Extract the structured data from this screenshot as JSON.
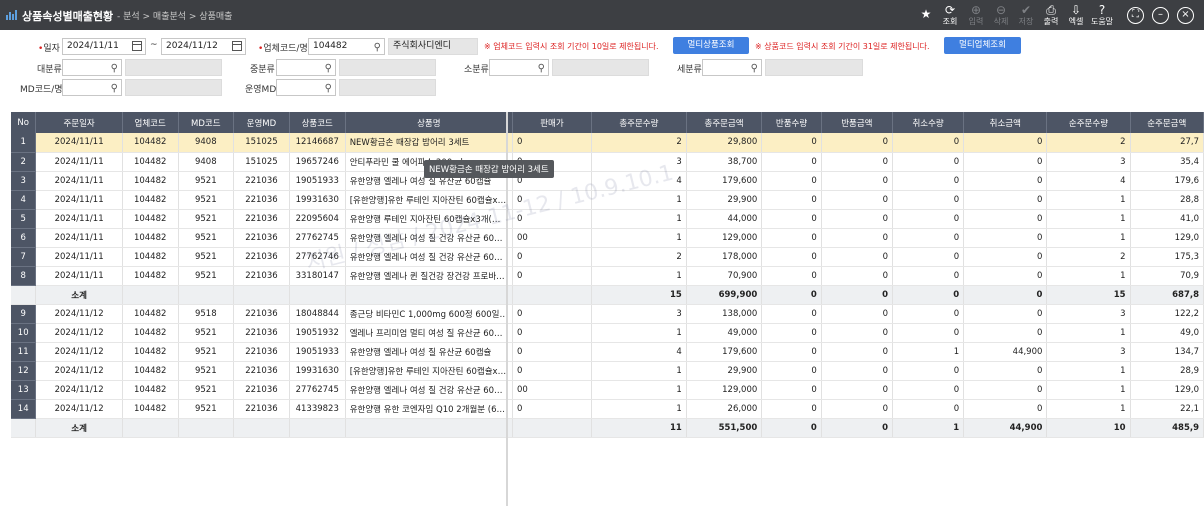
{
  "title": "상품속성별매출현황",
  "breadcrumb": "- 분석 > 매출분석 > 상품매출",
  "toolbar": [
    {
      "label": "조회",
      "icon": "refresh-icon",
      "disabled": false
    },
    {
      "label": "입력",
      "icon": "plus-icon",
      "disabled": true
    },
    {
      "label": "삭제",
      "icon": "minus-icon",
      "disabled": true
    },
    {
      "label": "저장",
      "icon": "check-icon",
      "disabled": true
    },
    {
      "label": "출력",
      "icon": "printer-icon",
      "disabled": false
    },
    {
      "label": "엑셀",
      "icon": "download-icon",
      "disabled": false
    },
    {
      "label": "도움말",
      "icon": "help-icon",
      "disabled": false
    }
  ],
  "search": {
    "date_label": "일자",
    "date_from": "2024/11/11",
    "date_sep": "~",
    "date_to": "2024/11/12",
    "vendor_label": "업체코드/명",
    "vendor_code": "104482",
    "vendor_name": "주식회사디엔디",
    "warn_vendor": "※ 업체코드 입력시 조회 기간이 10일로 제한됩니다.",
    "multi_product_btn": "멀티상품조회",
    "warn_product": "※ 상품코드 입력시 조회 기간이 31일로 제한됩니다.",
    "multi_vendor_btn": "멀티업체조회",
    "cat_large_label": "대분류",
    "cat_mid_label": "중분류",
    "cat_small_label": "소분류",
    "cat_detail_label": "세분류",
    "md_label": "MD코드/명",
    "ops_md_label": "운영MD"
  },
  "grid": {
    "columns": [
      "No",
      "주문일자",
      "업체코드",
      "MD코드",
      "운영MD",
      "상품코드",
      "상품명",
      "판매가",
      "총주문수량",
      "총주문금액",
      "반품수량",
      "반품금액",
      "취소수량",
      "취소금액",
      "순주문수량",
      "순주문금액"
    ],
    "rows": [
      {
        "no": "1",
        "date": "2024/11/11",
        "vendor": "104482",
        "md": "9408",
        "opmd": "151025",
        "code": "12146687",
        "name": "NEW황금손 때장갑 밤어리 3세트",
        "price": "0",
        "qty": "2",
        "amt": "29,800",
        "rqty": "0",
        "ramt": "0",
        "cqty": "0",
        "camt": "0",
        "nqty": "2",
        "namt": "27,7",
        "selected": true
      },
      {
        "no": "2",
        "date": "2024/11/11",
        "vendor": "104482",
        "md": "9408",
        "opmd": "151025",
        "code": "19657246",
        "name": "안티푸라민 쿨 에어파스 200ml",
        "price": "0",
        "qty": "3",
        "amt": "38,700",
        "rqty": "0",
        "ramt": "0",
        "cqty": "0",
        "camt": "0",
        "nqty": "3",
        "namt": "35,4"
      },
      {
        "no": "3",
        "date": "2024/11/11",
        "vendor": "104482",
        "md": "9521",
        "opmd": "221036",
        "code": "19051933",
        "name": "유한양행 엘레나 여성 질 유산균 60캡슐",
        "price": "0",
        "qty": "4",
        "amt": "179,600",
        "rqty": "0",
        "ramt": "0",
        "cqty": "0",
        "camt": "0",
        "nqty": "4",
        "namt": "179,6"
      },
      {
        "no": "4",
        "date": "2024/11/11",
        "vendor": "104482",
        "md": "9521",
        "opmd": "221036",
        "code": "19931630",
        "name": "[유한양행]유한 루테인 지아잔틴 60캡슐x…",
        "price": "0",
        "qty": "1",
        "amt": "29,900",
        "rqty": "0",
        "ramt": "0",
        "cqty": "0",
        "camt": "0",
        "nqty": "1",
        "namt": "28,8"
      },
      {
        "no": "5",
        "date": "2024/11/11",
        "vendor": "104482",
        "md": "9521",
        "opmd": "221036",
        "code": "22095604",
        "name": "유한양행 루테인 지아잔틴 60캡슐x3개(…",
        "price": "0",
        "qty": "1",
        "amt": "44,000",
        "rqty": "0",
        "ramt": "0",
        "cqty": "0",
        "camt": "0",
        "nqty": "1",
        "namt": "41,0"
      },
      {
        "no": "6",
        "date": "2024/11/11",
        "vendor": "104482",
        "md": "9521",
        "opmd": "221036",
        "code": "27762745",
        "name": "유한양행 엘레나 여성 질 건강 유산균 60…",
        "price": "00",
        "qty": "1",
        "amt": "129,000",
        "rqty": "0",
        "ramt": "0",
        "cqty": "0",
        "camt": "0",
        "nqty": "1",
        "namt": "129,0"
      },
      {
        "no": "7",
        "date": "2024/11/11",
        "vendor": "104482",
        "md": "9521",
        "opmd": "221036",
        "code": "27762746",
        "name": "유한양행 엘레나 여성 질 건강 유산균 60…",
        "price": "0",
        "qty": "2",
        "amt": "178,000",
        "rqty": "0",
        "ramt": "0",
        "cqty": "0",
        "camt": "0",
        "nqty": "2",
        "namt": "175,3"
      },
      {
        "no": "8",
        "date": "2024/11/11",
        "vendor": "104482",
        "md": "9521",
        "opmd": "221036",
        "code": "33180147",
        "name": "유한양행 엘레나 퀸 질건강 장건강 프로바…",
        "price": "0",
        "qty": "1",
        "amt": "70,900",
        "rqty": "0",
        "ramt": "0",
        "cqty": "0",
        "camt": "0",
        "nqty": "1",
        "namt": "70,9"
      },
      {
        "subtotal": true,
        "date": "소계",
        "qty": "15",
        "amt": "699,900",
        "rqty": "0",
        "ramt": "0",
        "cqty": "0",
        "camt": "0",
        "nqty": "15",
        "namt": "687,8"
      },
      {
        "no": "9",
        "date": "2024/11/12",
        "vendor": "104482",
        "md": "9518",
        "opmd": "221036",
        "code": "18048844",
        "name": "종근당 비타민C 1,000mg 600정 600일…",
        "price": "0",
        "qty": "3",
        "amt": "138,000",
        "rqty": "0",
        "ramt": "0",
        "cqty": "0",
        "camt": "0",
        "nqty": "3",
        "namt": "122,2"
      },
      {
        "no": "10",
        "date": "2024/11/12",
        "vendor": "104482",
        "md": "9521",
        "opmd": "221036",
        "code": "19051932",
        "name": "엘레나 프리미엄 멀티 여성 질 유산균 60…",
        "price": "0",
        "qty": "1",
        "amt": "49,000",
        "rqty": "0",
        "ramt": "0",
        "cqty": "0",
        "camt": "0",
        "nqty": "1",
        "namt": "49,0"
      },
      {
        "no": "11",
        "date": "2024/11/12",
        "vendor": "104482",
        "md": "9521",
        "opmd": "221036",
        "code": "19051933",
        "name": "유한양행 엘레나 여성 질 유산균 60캡슐",
        "price": "0",
        "qty": "4",
        "amt": "179,600",
        "rqty": "0",
        "ramt": "0",
        "cqty": "1",
        "camt": "44,900",
        "nqty": "3",
        "namt": "134,7"
      },
      {
        "no": "12",
        "date": "2024/11/12",
        "vendor": "104482",
        "md": "9521",
        "opmd": "221036",
        "code": "19931630",
        "name": "[유한양행]유한 루테인 지아잔틴 60캡슐x…",
        "price": "0",
        "qty": "1",
        "amt": "29,900",
        "rqty": "0",
        "ramt": "0",
        "cqty": "0",
        "camt": "0",
        "nqty": "1",
        "namt": "28,9"
      },
      {
        "no": "13",
        "date": "2024/11/12",
        "vendor": "104482",
        "md": "9521",
        "opmd": "221036",
        "code": "27762745",
        "name": "유한양행 엘레나 여성 질 건강 유산균 60…",
        "price": "00",
        "qty": "1",
        "amt": "129,000",
        "rqty": "0",
        "ramt": "0",
        "cqty": "0",
        "camt": "0",
        "nqty": "1",
        "namt": "129,0"
      },
      {
        "no": "14",
        "date": "2024/11/12",
        "vendor": "104482",
        "md": "9521",
        "opmd": "221036",
        "code": "41339823",
        "name": "유한양행 유한 코엔자임 Q10 2개월분 (6…",
        "price": "0",
        "qty": "1",
        "amt": "26,000",
        "rqty": "0",
        "ramt": "0",
        "cqty": "0",
        "camt": "0",
        "nqty": "1",
        "namt": "22,1"
      },
      {
        "subtotal": true,
        "date": "소계",
        "qty": "11",
        "amt": "551,500",
        "rqty": "0",
        "ramt": "0",
        "cqty": "1",
        "camt": "44,900",
        "nqty": "10",
        "namt": "485,9"
      }
    ]
  },
  "tooltip": "NEW황금손 때장갑 밤어리 3세트",
  "watermark": "지원 / 성남 / 2024-11-12 / 10.9.10.1"
}
